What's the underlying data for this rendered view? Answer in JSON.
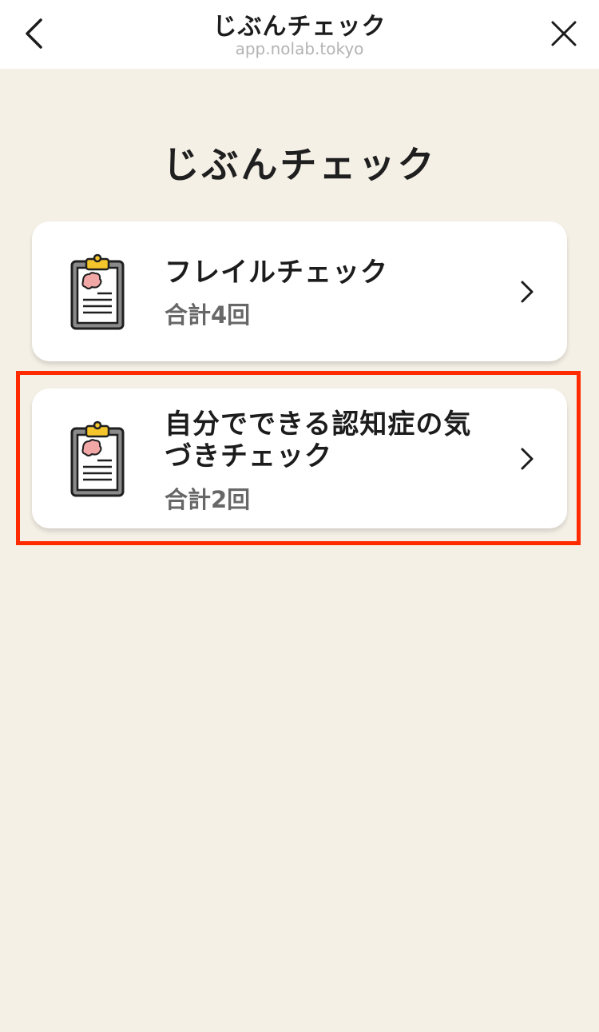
{
  "header": {
    "title": "じぶんチェック",
    "url": "app.nolab.tokyo",
    "back_icon": "chevron-left-icon",
    "close_icon": "close-icon"
  },
  "page": {
    "title": "じぶんチェック"
  },
  "cards": [
    {
      "name": "フレイルチェック",
      "count": "合計4回",
      "icon": "clipboard-brain-icon"
    },
    {
      "name": "自分でできる認知症の気づきチェック",
      "count": "合計2回",
      "icon": "clipboard-brain-icon"
    }
  ],
  "colors": {
    "background": "#f5f0e6",
    "card": "#ffffff",
    "highlight": "#ff2a00",
    "clip": "#f5c52c",
    "brain": "#f2a7a7"
  }
}
